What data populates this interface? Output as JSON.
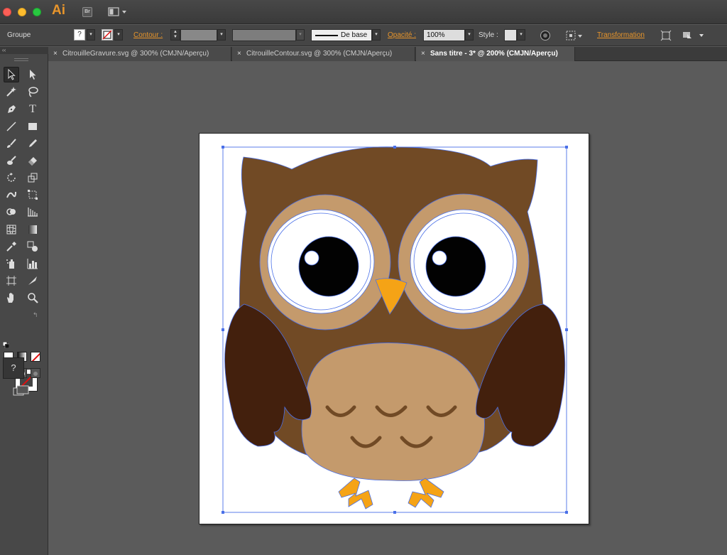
{
  "app": {
    "logo": "Ai",
    "bridge_label": "Br"
  },
  "controlbar": {
    "selection_label": "Groupe",
    "fill_value": "?",
    "stroke_label": "Contour :",
    "stroke_profile": "De base",
    "opacity_label": "Opacité :",
    "opacity_value": "100%",
    "style_label": "Style :",
    "transform_label": "Transformation"
  },
  "tabs": [
    {
      "label": "CitrouilleGravure.svg @ 300% (CMJN/Aperçu)",
      "close": "×"
    },
    {
      "label": "CitrouilleContour.svg @ 300% (CMJN/Aperçu)",
      "close": "×"
    },
    {
      "label": "Sans titre - 3* @ 200% (CMJN/Aperçu)",
      "close": "×"
    }
  ],
  "tools": {
    "panel_collapse": "‹‹",
    "fill_value": "?"
  },
  "colors": {
    "accent": "#e8952b",
    "owl_body": "#714a25",
    "owl_face": "#c49a6c",
    "owl_wing": "#43200d",
    "owl_beak": "#f5a316",
    "selection": "#4a70e8"
  }
}
